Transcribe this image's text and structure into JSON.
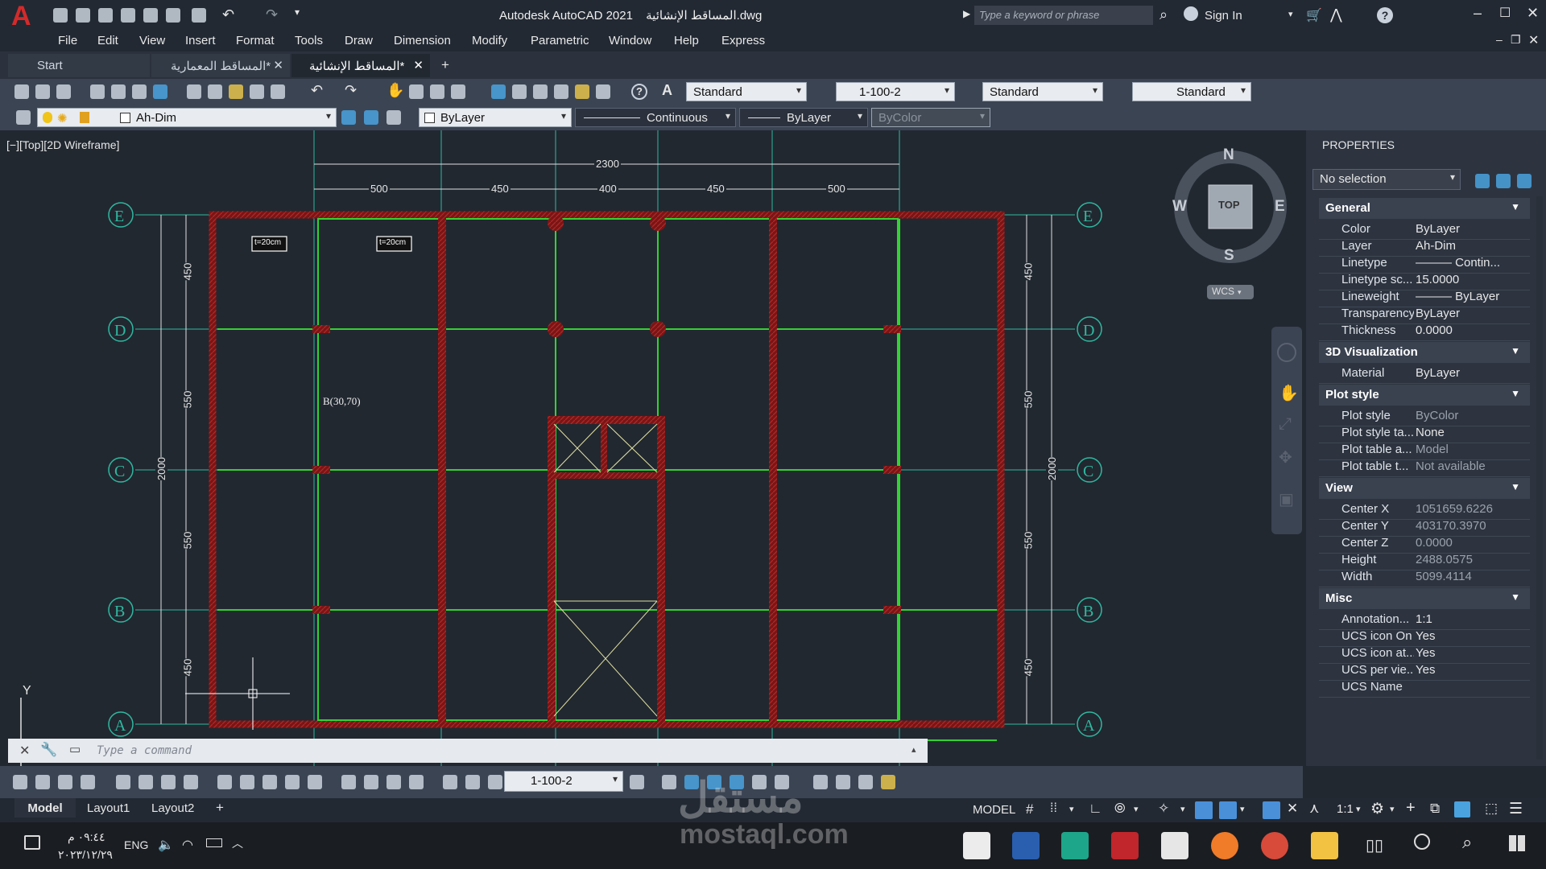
{
  "title": {
    "app": "Autodesk AutoCAD 2021",
    "file": "المساقط الإنشائية.dwg",
    "search_placeholder": "Type a keyword or phrase",
    "sign_in": "Sign In",
    "help": "?"
  },
  "menu": [
    "File",
    "Edit",
    "View",
    "Insert",
    "Format",
    "Tools",
    "Draw",
    "Dimension",
    "Modify",
    "Parametric",
    "Window",
    "Help",
    "Express"
  ],
  "tabs": [
    {
      "label": "Start"
    },
    {
      "label": "المساقط المعمارية*"
    },
    {
      "label": "المساقط الإنشائية*"
    }
  ],
  "toolbar1": {
    "text_style": "Standard",
    "dim_style": "1-100-2",
    "table_style": "Standard",
    "multileader_style": "Standard"
  },
  "toolbar2": {
    "layer": "Ah-Dim",
    "color": "ByLayer",
    "linetype": "Continuous",
    "lineweight": "ByLayer",
    "plotstyle": "ByColor"
  },
  "viewport": {
    "label": "[−][Top][2D Wireframe]",
    "viewcube": {
      "n": "N",
      "s": "S",
      "e": "E",
      "w": "W",
      "top": "TOP",
      "wcs": "WCS"
    },
    "ucs_y": "Y",
    "grid_labels": [
      "E",
      "D",
      "C",
      "B",
      "A"
    ],
    "top_total": "2300",
    "top_dims": [
      "500",
      "450",
      "400",
      "450",
      "500"
    ],
    "side_dims": [
      "450",
      "550",
      "550",
      "450"
    ],
    "side_total": "2000",
    "slab_notes": [
      "t=20cm",
      "t=20cm"
    ],
    "beam_label": "B(30,70)",
    "command_placeholder": "Type  a  command"
  },
  "properties": {
    "title": "PROPERTIES",
    "selection": "No selection",
    "sections": [
      {
        "name": "General",
        "rows": [
          [
            "Color",
            "ByLayer"
          ],
          [
            "Layer",
            "Ah-Dim"
          ],
          [
            "Linetype",
            "——— Contin..."
          ],
          [
            "Linetype sc...",
            "15.0000"
          ],
          [
            "Lineweight",
            "——— ByLayer"
          ],
          [
            "Transparency",
            "ByLayer"
          ],
          [
            "Thickness",
            "0.0000"
          ]
        ]
      },
      {
        "name": "3D Visualization",
        "rows": [
          [
            "Material",
            "ByLayer"
          ]
        ]
      },
      {
        "name": "Plot style",
        "rows": [
          [
            "Plot style",
            "ByColor"
          ],
          [
            "Plot style ta...",
            "None"
          ],
          [
            "Plot table a...",
            "Model"
          ],
          [
            "Plot table t...",
            "Not available"
          ]
        ]
      },
      {
        "name": "View",
        "rows": [
          [
            "Center X",
            "1051659.6226"
          ],
          [
            "Center Y",
            "403170.3970"
          ],
          [
            "Center Z",
            "0.0000"
          ],
          [
            "Height",
            "2488.0575"
          ],
          [
            "Width",
            "5099.4114"
          ]
        ]
      },
      {
        "name": "Misc",
        "rows": [
          [
            "Annotation...",
            "1:1"
          ],
          [
            "UCS icon On",
            "Yes"
          ],
          [
            "UCS icon at...",
            "Yes"
          ],
          [
            "UCS per vie...",
            "Yes"
          ],
          [
            "UCS Name",
            ""
          ]
        ]
      }
    ]
  },
  "bottom": {
    "dim_style": "1-100-2",
    "layout_tabs": [
      "Model",
      "Layout1",
      "Layout2"
    ],
    "status_model": "MODEL",
    "scale": "1:1"
  },
  "watermark": {
    "arabic": "مستقل",
    "latin": "mostaql.com"
  },
  "taskbar": {
    "time": "٠٩:٤٤ م",
    "date": "٢٠٢٣/١٢/٢٩",
    "lang": "ENG"
  },
  "colors": {
    "accent": "#2fb8a0",
    "grid_circle": "#2fb8a0",
    "column": "#8b1a1a",
    "beam": "#32d232",
    "dim": "#e0e0e0"
  }
}
